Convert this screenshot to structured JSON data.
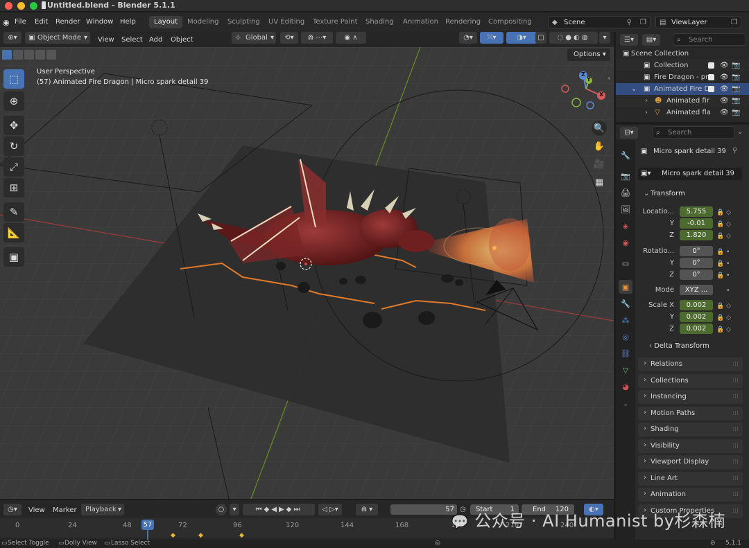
{
  "window": {
    "title": "Untitled.blend - Blender 5.1.1"
  },
  "menu": {
    "items": [
      "File",
      "Edit",
      "Render",
      "Window",
      "Help"
    ]
  },
  "workspaces": {
    "tabs": [
      "Layout",
      "Modeling",
      "Sculpting",
      "UV Editing",
      "Texture Paint",
      "Shading",
      "Animation",
      "Rendering",
      "Compositing"
    ],
    "active": "Layout"
  },
  "scene": {
    "value": "Scene"
  },
  "viewlayer": {
    "value": "ViewLayer"
  },
  "viewport_header": {
    "mode": "Object Mode",
    "menus": [
      "View",
      "Select",
      "Add",
      "Object"
    ],
    "orientation": "Global",
    "options_label": "Options"
  },
  "viewport": {
    "perspective_label": "User Perspective",
    "object_label": "(57) Animated Fire Dragon | Micro spark detail 39"
  },
  "gizmo": {
    "x": "X",
    "y": "Y",
    "z": "Z"
  },
  "outliner": {
    "search_placeholder": "Search",
    "root": "Scene Collection",
    "rows": [
      {
        "label": "Collection"
      },
      {
        "label": "Fire Dragon - pr"
      },
      {
        "label": "Animated Fire Dr"
      },
      {
        "label": "Animated fir"
      },
      {
        "label": "Animated fla"
      }
    ]
  },
  "properties": {
    "search_placeholder": "Search",
    "object_name": "Micro spark detail 39",
    "data_name": "Micro spark detail 39",
    "transform_label": "Transform",
    "location_label": "Locatio...",
    "rotation_label": "Rotatio...",
    "scale_label": "Scale X",
    "y_label": "Y",
    "z_label": "Z",
    "location": {
      "x": "5.755",
      "y": "-0.01",
      "z": "1.820"
    },
    "rotation": {
      "x": "0°",
      "y": "0°",
      "z": "0°"
    },
    "mode_label": "Mode",
    "mode_value": "XYZ ...",
    "scale": {
      "x": "0.002",
      "y": "0.002",
      "z": "0.002"
    },
    "delta_label": "Delta Transform",
    "panels": [
      "Relations",
      "Collections",
      "Instancing",
      "Motion Paths",
      "Shading",
      "Visibility",
      "Viewport Display",
      "Line Art",
      "Animation",
      "Custom Properties"
    ]
  },
  "timeline": {
    "menus": [
      "View",
      "Marker"
    ],
    "playback_label": "Playback",
    "current_frame": "57",
    "start_label": "Start",
    "start_value": "1",
    "end_label": "End",
    "end_value": "120",
    "ruler_labels": [
      "0",
      "24",
      "48",
      "72",
      "96",
      "120",
      "144",
      "168",
      "192",
      "216",
      "240"
    ],
    "current_marker": "57"
  },
  "statusbar": {
    "items": [
      "Select Toggle",
      "Dolly View",
      "Lasso Select"
    ],
    "version": "5.1.1"
  },
  "watermark": {
    "text": "公众号 · AI Humanist by杉森楠"
  },
  "colors": {
    "accent": "#4772b3",
    "field_green": "#4d6b2e",
    "dragon": "#6e1f1f",
    "fire": "#e0894a"
  }
}
